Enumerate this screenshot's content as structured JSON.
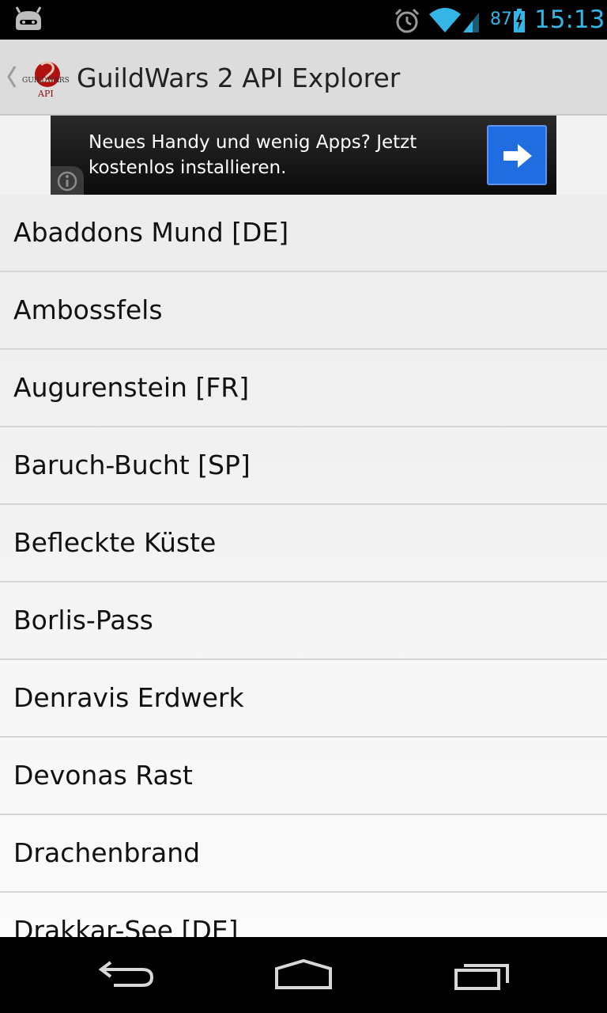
{
  "status_bar": {
    "battery_percent": "87",
    "time": "15:13",
    "icons": [
      "cyanogenmod-android-icon",
      "alarm-icon",
      "wifi-icon",
      "signal-icon",
      "battery-charging-icon"
    ],
    "accent_color": "#33b5e5"
  },
  "action_bar": {
    "title": "GuildWars 2 API Explorer",
    "logo_text": "GUILDWARS 2",
    "logo_subtext": "API",
    "icons": [
      "up-chevron-icon",
      "app-logo-icon"
    ]
  },
  "ad": {
    "text": "Neues Handy und wenig Apps? Jetzt kostenlos installieren.",
    "icons": [
      "info-icon",
      "arrow-right-icon"
    ],
    "button_color": "#1f6de0"
  },
  "servers": [
    {
      "name": "Abaddons Mund [DE]"
    },
    {
      "name": "Ambossfels"
    },
    {
      "name": "Augurenstein [FR]"
    },
    {
      "name": "Baruch-Bucht [SP]"
    },
    {
      "name": "Befleckte Küste"
    },
    {
      "name": "Borlis-Pass"
    },
    {
      "name": "Denravis Erdwerk"
    },
    {
      "name": "Devonas Rast"
    },
    {
      "name": "Drachenbrand"
    },
    {
      "name": "Drakkar-See [DE]"
    }
  ],
  "nav_bar": {
    "icons": [
      "back-icon",
      "home-icon",
      "recent-apps-icon"
    ]
  }
}
